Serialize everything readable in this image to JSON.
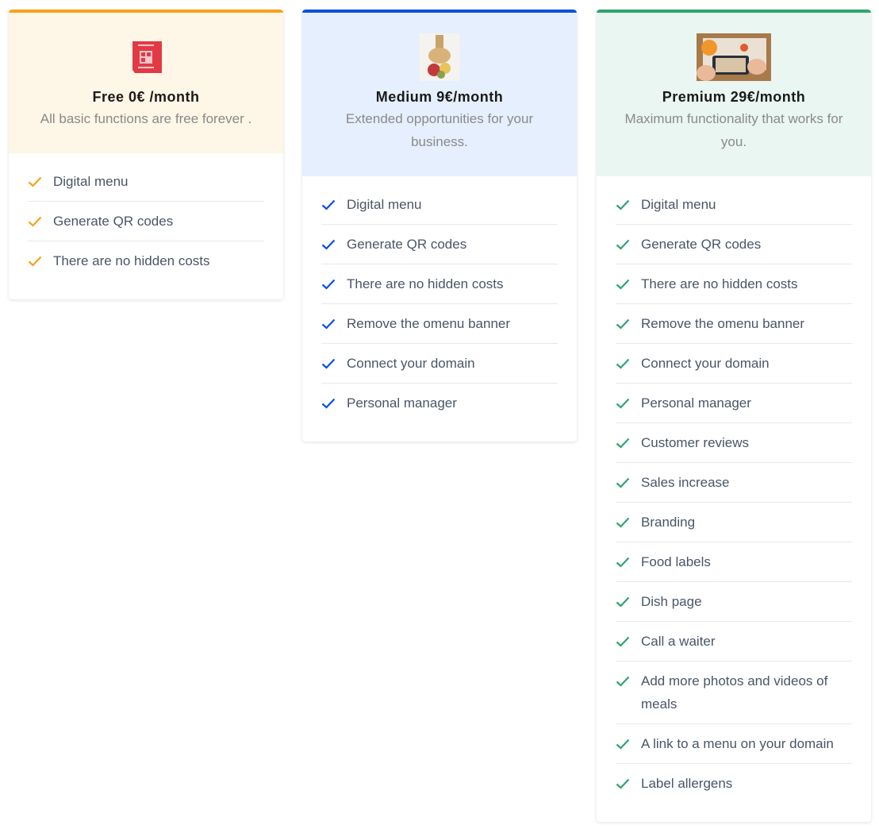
{
  "plans": [
    {
      "id": "free",
      "accent": "#f7a21b",
      "header_bg": "#fef6e6",
      "image": "qr-sticker-image",
      "title": "Free 0€ /month",
      "description": "All basic functions are free forever .",
      "features": [
        "Digital menu",
        "Generate QR codes",
        "There are no hidden costs"
      ]
    },
    {
      "id": "medium",
      "accent": "#0a4fe0",
      "header_bg": "#e6effd",
      "image": "food-board-image",
      "title": "Medium 9€/month",
      "description": "Extended opportunities for your business.",
      "features": [
        "Digital menu",
        "Generate QR codes",
        "There are no hidden costs",
        "Remove the omenu banner",
        "Connect your domain",
        "Personal manager"
      ]
    },
    {
      "id": "premium",
      "accent": "#2ea46f",
      "header_bg": "#eaf6f1",
      "image": "phone-food-photo-image",
      "title": "Premium 29€/month",
      "description": "Maximum functionality that works for you.",
      "features": [
        "Digital menu",
        "Generate QR codes",
        "There are no hidden costs",
        "Remove the omenu banner",
        "Connect your domain",
        "Personal manager",
        "Customer reviews",
        "Sales increase",
        "Branding",
        "Food labels",
        "Dish page",
        "Call a waiter",
        "Add more photos and videos of meals",
        "A link to a menu on your domain",
        "Label allergens"
      ]
    }
  ]
}
